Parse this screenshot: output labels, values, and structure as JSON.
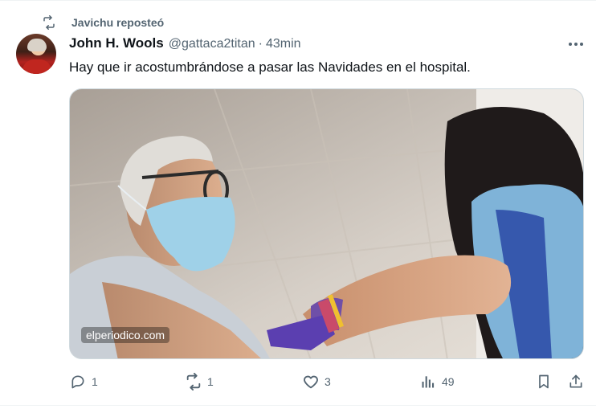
{
  "repost": {
    "label": "Javichu reposteó"
  },
  "author": {
    "name": "John H. Wools",
    "handle": "@gattaca2titan",
    "separator": "·",
    "time": "43min"
  },
  "tweet": {
    "text": "Hay que ir acostumbrándose a pasar las Navidades en el hospital."
  },
  "media": {
    "watermark": "elperiodico.com"
  },
  "actions": {
    "replies": "1",
    "reposts": "1",
    "likes": "3",
    "views": "49"
  },
  "icons": [
    "repost-icon",
    "more-icon",
    "reply-icon",
    "like-icon",
    "views-icon",
    "bookmark-icon",
    "share-icon"
  ],
  "colors": {
    "text": "#0f1419",
    "secondary": "#536471",
    "border": "#cfd9de"
  }
}
